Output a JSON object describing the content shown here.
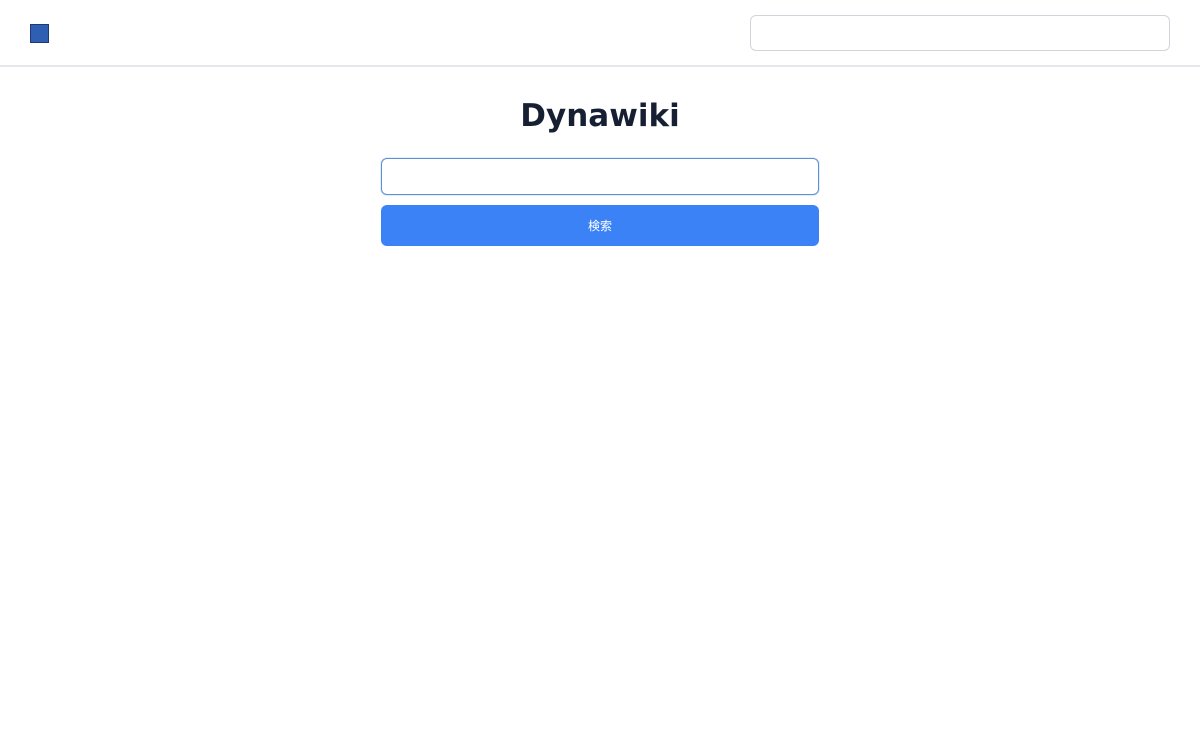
{
  "header": {
    "logo_icon": "square-logo-icon",
    "search": {
      "value": "",
      "placeholder": ""
    }
  },
  "main": {
    "title": "Dynawiki",
    "search": {
      "value": "",
      "placeholder": ""
    },
    "search_button_label": "検索"
  },
  "colors": {
    "accent": "#3b82f6",
    "logo": "#2f5fb3",
    "title_text": "#172033",
    "focus_border": "#5b8fd6"
  }
}
